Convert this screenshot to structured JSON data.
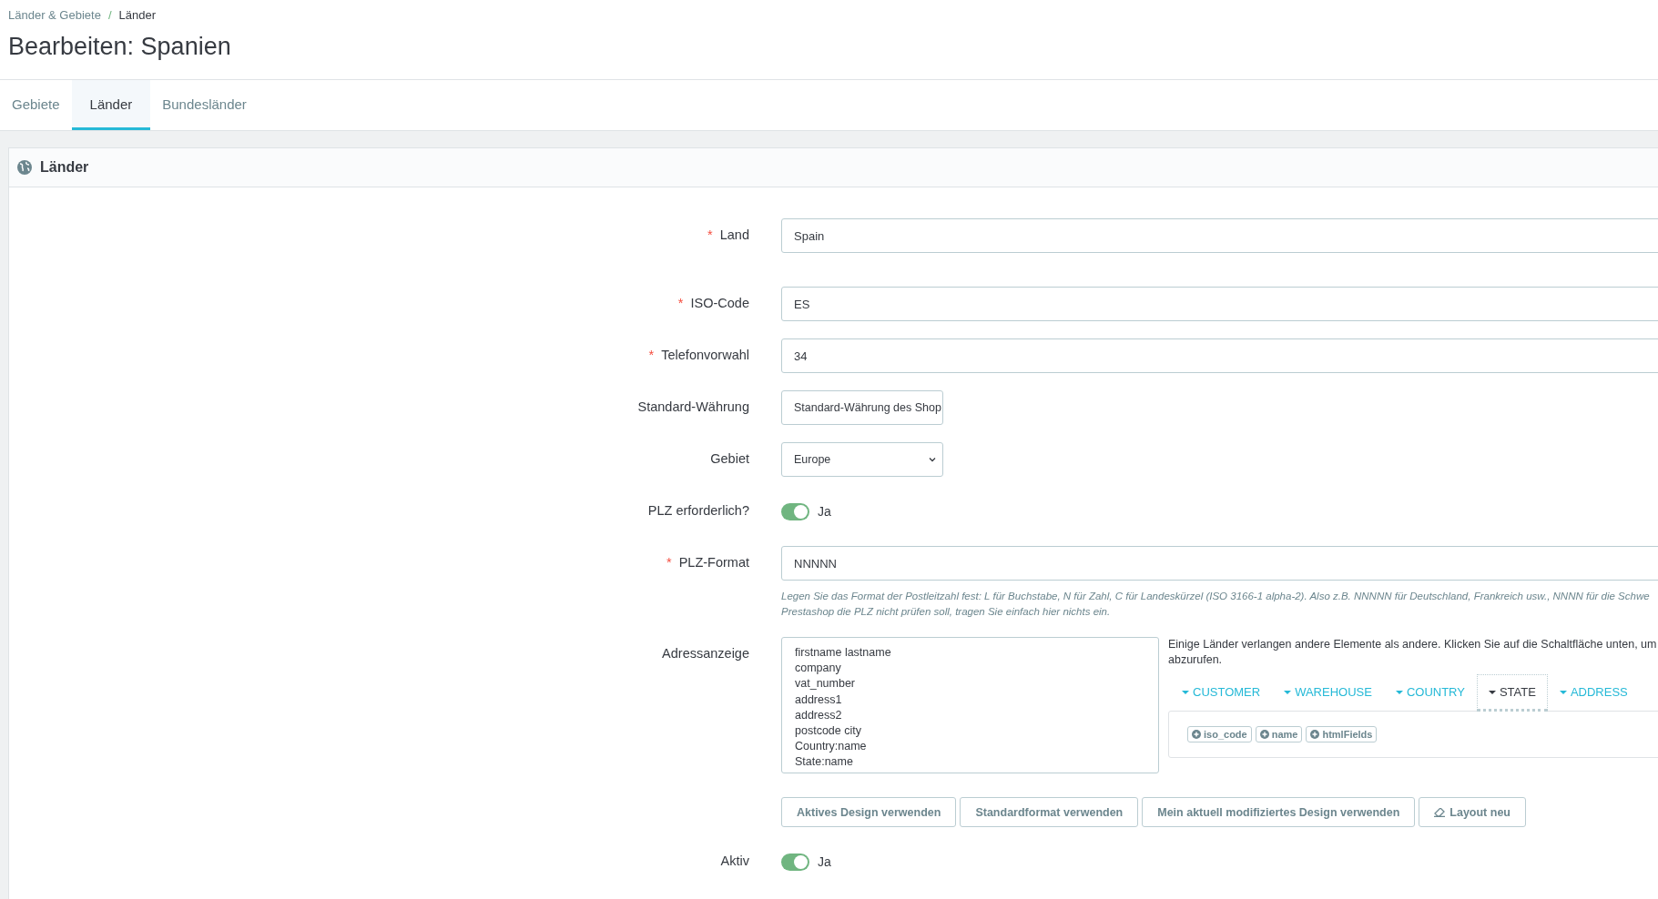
{
  "breadcrumb": {
    "items": [
      "Länder & Gebiete",
      "Länder"
    ],
    "separator": "/"
  },
  "page_title": "Bearbeiten: Spanien",
  "tabs": [
    {
      "label": "Gebiete",
      "selected": false
    },
    {
      "label": "Länder",
      "selected": true
    },
    {
      "label": "Bundesländer",
      "selected": false
    }
  ],
  "panel": {
    "title": "Länder"
  },
  "required_mark": "*",
  "fields": [
    {
      "kind": "text",
      "label": "Land",
      "required": true,
      "value": "Spain"
    },
    {
      "kind": "text",
      "label": "ISO-Code",
      "required": true,
      "value": "ES"
    },
    {
      "kind": "text",
      "label": "Telefonvorwahl",
      "required": true,
      "value": "34"
    },
    {
      "kind": "select",
      "label": "Standard-Währung",
      "required": false,
      "value": "Standard-Währung des Shop"
    },
    {
      "kind": "select",
      "label": "Gebiet",
      "required": false,
      "value": "Europe"
    },
    {
      "kind": "toggle",
      "label": "PLZ erforderlich?",
      "required": false,
      "on": true,
      "state_label": "Ja"
    },
    {
      "kind": "text",
      "label": "PLZ-Format",
      "required": true,
      "value": "NNNNN",
      "help": [
        "Legen Sie das Format der Postleitzahl fest: L für Buchstabe, N für Zahl, C für Landeskürzel (ISO 3166-1 alpha-2). Also z.B. NNNNN für Deutschland, Frankreich usw., NNNN für die Schwe",
        "Prestashop die PLZ nicht prüfen soll, tragen Sie einfach hier nichts ein."
      ]
    },
    {
      "kind": "address",
      "label": "Adressanzeige",
      "required": false,
      "lines": [
        "firstname lastname",
        "company",
        "vat_number",
        "address1",
        "address2",
        "postcode city",
        "Country:name",
        "State:name"
      ],
      "info": [
        "Einige Länder verlangen andere Elemente als andere. Klicken Sie auf die Schaltfläche unten, um",
        "abzurufen."
      ],
      "tabs": [
        {
          "label": "CUSTOMER",
          "selected": false
        },
        {
          "label": "WAREHOUSE",
          "selected": false
        },
        {
          "label": "COUNTRY",
          "selected": false
        },
        {
          "label": "STATE",
          "selected": true
        },
        {
          "label": "ADDRESS",
          "selected": false
        }
      ],
      "tokens": [
        "iso_code",
        "name",
        "htmlFields"
      ],
      "buttons": [
        {
          "label": "Aktives Design verwenden",
          "kind": "plain"
        },
        {
          "label": "Standardformat verwenden",
          "kind": "plain"
        },
        {
          "label": "Mein aktuell modifiziertes Design verwenden",
          "kind": "plain"
        },
        {
          "label": "Layout neu",
          "kind": "eraser"
        }
      ]
    },
    {
      "kind": "toggle",
      "label": "Aktiv",
      "required": false,
      "on": true,
      "state_label": "Ja"
    }
  ]
}
